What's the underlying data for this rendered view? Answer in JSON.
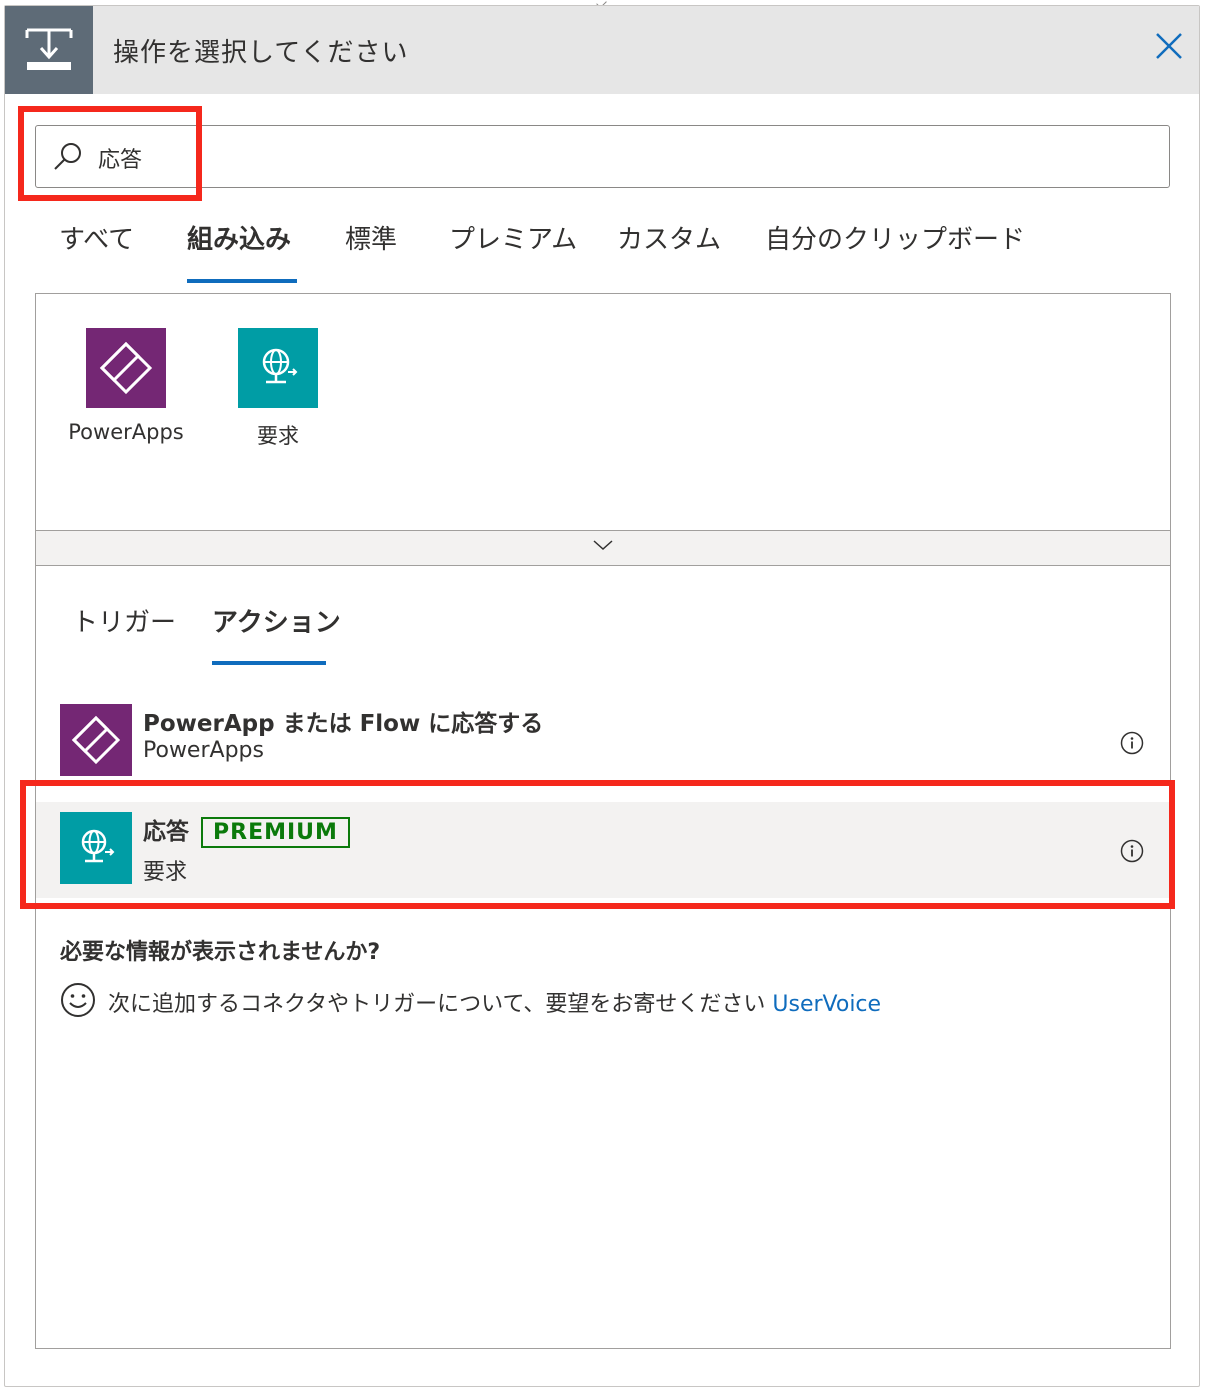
{
  "header": {
    "title": "操作を選択してください",
    "icon": "insert-step-icon",
    "close": "close-icon"
  },
  "search": {
    "value": "応答",
    "icon": "search-icon"
  },
  "category_tabs": [
    {
      "label": "すべて",
      "active": false
    },
    {
      "label": "組み込み",
      "active": true
    },
    {
      "label": "標準",
      "active": false
    },
    {
      "label": "プレミアム",
      "active": false
    },
    {
      "label": "カスタム",
      "active": false
    },
    {
      "label": "自分のクリップボード",
      "active": false
    }
  ],
  "connectors": [
    {
      "label": "PowerApps",
      "icon": "powerapps-icon",
      "color": "#742774"
    },
    {
      "label": "要求",
      "icon": "request-globe-icon",
      "color": "#009DA5"
    }
  ],
  "collapse": {
    "icon": "chevron-down-icon"
  },
  "sub_tabs": [
    {
      "label": "トリガー",
      "active": false
    },
    {
      "label": "アクション",
      "active": true
    }
  ],
  "actions": [
    {
      "title": "PowerApp または Flow に応答する",
      "subtitle": "PowerApps",
      "icon": "powerapps-icon",
      "color": "#742774",
      "badge": ""
    },
    {
      "title": "応答",
      "subtitle": "要求",
      "icon": "request-globe-icon",
      "color": "#009DA5",
      "badge": "PREMIUM"
    }
  ],
  "missing": {
    "question": "必要な情報が表示されませんか?",
    "text": "次に追加するコネクタやトリガーについて、要望をお寄せください",
    "link": "UserVoice",
    "icon": "smiley-icon"
  },
  "colors": {
    "accent": "#0f6cbd",
    "highlight": "#f5281c",
    "premium": "#0b7a0b"
  }
}
